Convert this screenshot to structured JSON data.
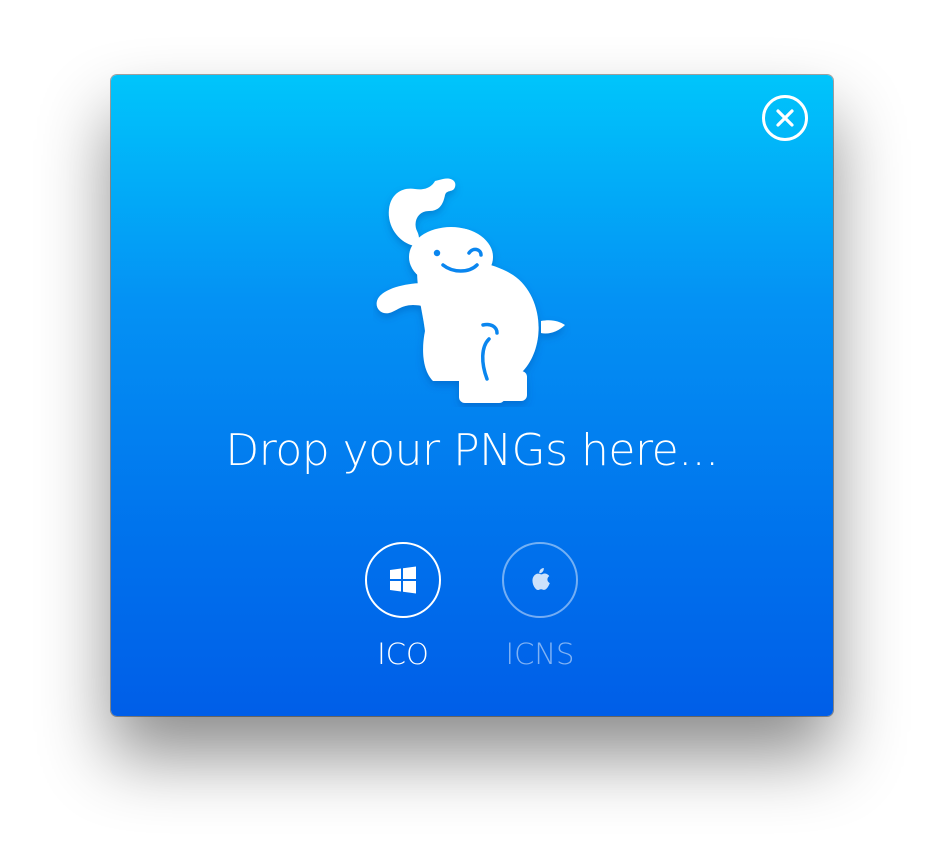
{
  "window": {
    "close_icon": "close-circle-icon",
    "mascot_icon": "elephant-icon"
  },
  "drop_zone": {
    "prompt": "Drop your PNGs here..."
  },
  "formats": [
    {
      "label": "ICO",
      "icon": "windows-logo-icon",
      "active": true
    },
    {
      "label": "ICNS",
      "icon": "apple-logo-icon",
      "active": false
    }
  ],
  "colors": {
    "gradient_top": "#00c5fb",
    "gradient_bottom": "#005ee8",
    "foreground": "#ffffff"
  }
}
